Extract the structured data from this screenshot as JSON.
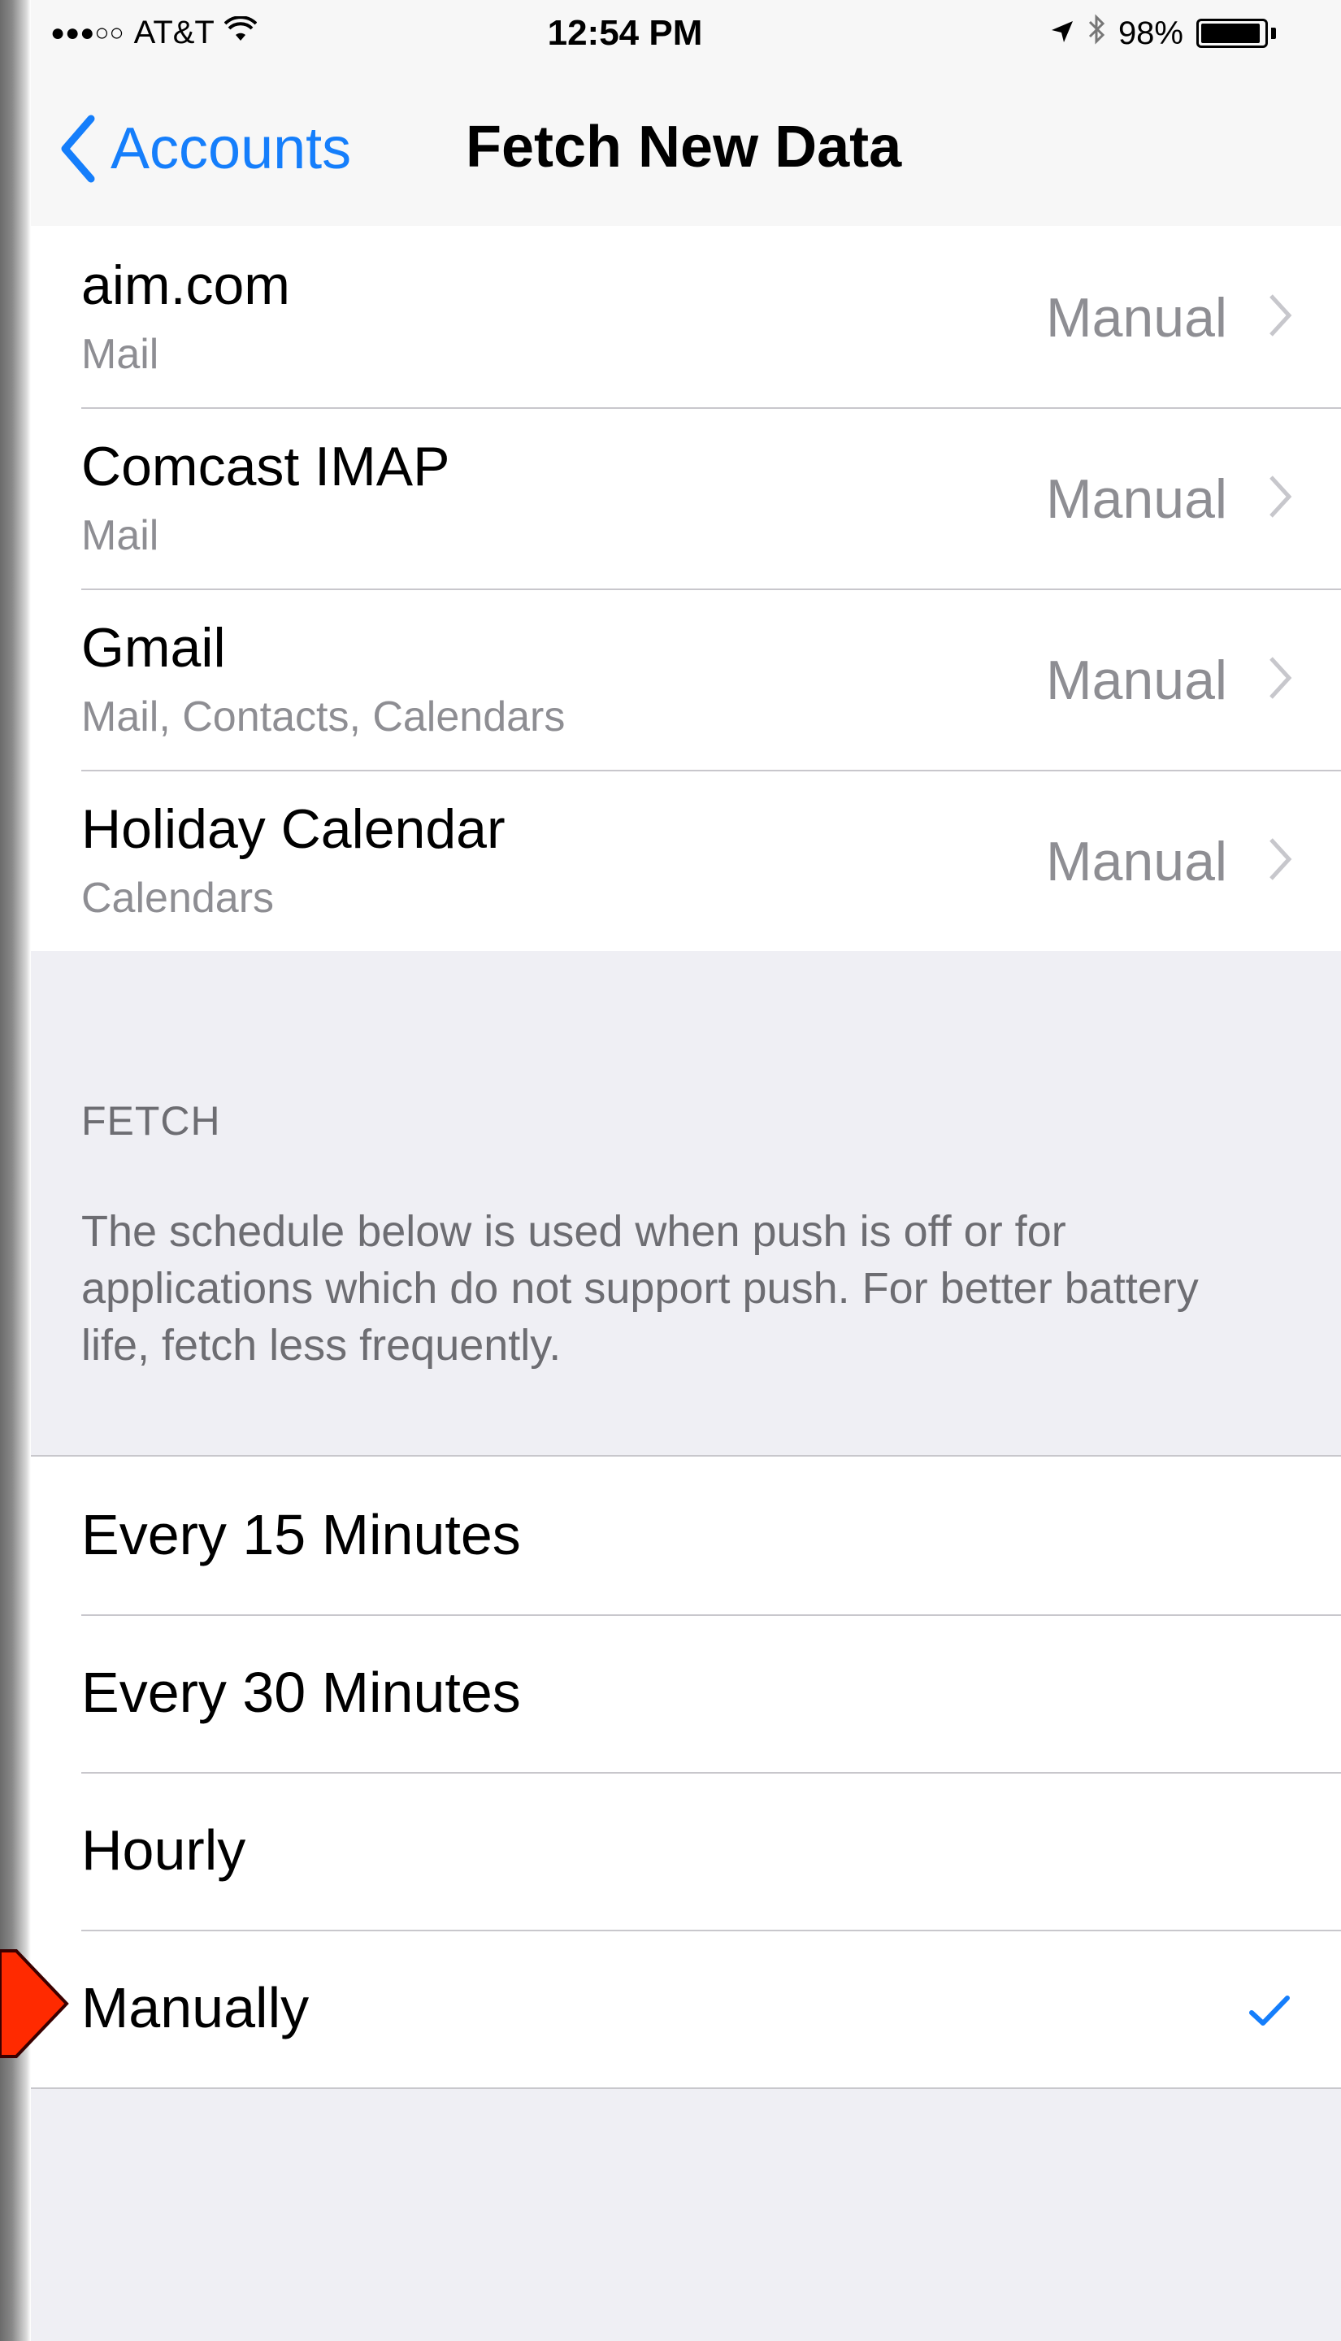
{
  "status_bar": {
    "carrier": "AT&T",
    "signal": "●●●○○",
    "time": "12:54 PM",
    "battery": "98%",
    "battery_level": 0.98
  },
  "nav": {
    "back_label": "Accounts",
    "title": "Fetch New Data"
  },
  "accounts": [
    {
      "name": "aim.com",
      "sub": "Mail",
      "value": "Manual"
    },
    {
      "name": "Comcast IMAP",
      "sub": "Mail",
      "value": "Manual"
    },
    {
      "name": "Gmail",
      "sub": "Mail, Contacts, Calendars",
      "value": "Manual"
    },
    {
      "name": "Holiday Calendar",
      "sub": "Calendars",
      "value": "Manual"
    }
  ],
  "fetch": {
    "header": "FETCH",
    "footer": "The schedule below is used when push is off or for applications which do not support push. For better battery life, fetch less frequently.",
    "options": [
      {
        "label": "Every 15 Minutes",
        "selected": false
      },
      {
        "label": "Every 30 Minutes",
        "selected": false
      },
      {
        "label": "Hourly",
        "selected": false
      },
      {
        "label": "Manually",
        "selected": true
      }
    ]
  },
  "colors": {
    "accent": "#157efb",
    "background": "#efeff4",
    "secondary_text": "#8e8e93",
    "annotation": "#ff2a00"
  }
}
